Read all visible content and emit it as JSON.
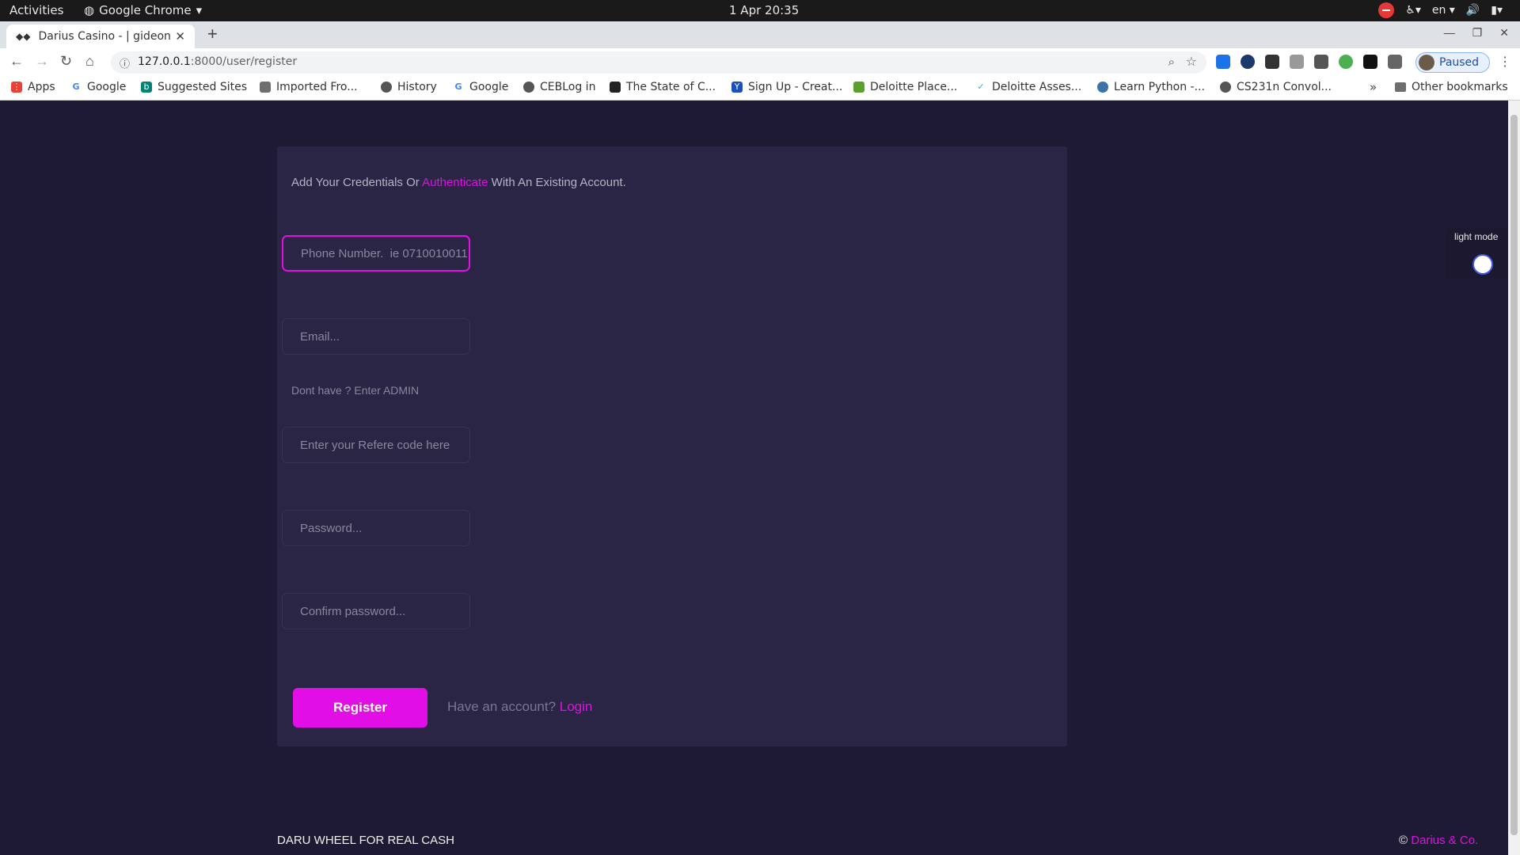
{
  "system_bar": {
    "activities": "Activities",
    "app_name": "Google Chrome",
    "clock": "1 Apr  20:35",
    "lang": "en"
  },
  "browser": {
    "tab_title": "Darius Casino - | gideongi",
    "url_host": "127.0.0.1",
    "url_path": ":8000/user/register",
    "profile_status": "Paused",
    "bookmarks": [
      "Apps",
      "Google",
      "Suggested Sites",
      "Imported Fro...",
      "History",
      "Google",
      "CEBLog in",
      "The State of C...",
      "Sign Up - Creat...",
      "Deloitte Place...",
      "Deloitte Asses...",
      "Learn Python -...",
      "CS231n Convol..."
    ],
    "other_bookmarks": "Other bookmarks",
    "more": "»"
  },
  "form": {
    "intro_pre": "Add Your Credentials Or ",
    "intro_link": "Authenticate",
    "intro_post": " With An Existing Account.",
    "phone_placeholder": "Phone Number.  ie 0710010011",
    "email_placeholder": "Email...",
    "admin_hint": "Dont have ? Enter ADMIN",
    "referral_placeholder": "Enter your Refere code here",
    "password_placeholder": "Password...",
    "confirm_placeholder": "Confirm password...",
    "register_label": "Register",
    "have_account": "Have an account? ",
    "login_link": "Login"
  },
  "footer": {
    "left": "DARU WHEEL FOR REAL CASH",
    "copyright": "© ",
    "brand": "Darius & Co."
  },
  "theme_toggle": {
    "label": "light mode"
  },
  "colors": {
    "accent": "#e00fe3",
    "page_bg": "#1e1a33",
    "card_bg": "#2a2445"
  }
}
